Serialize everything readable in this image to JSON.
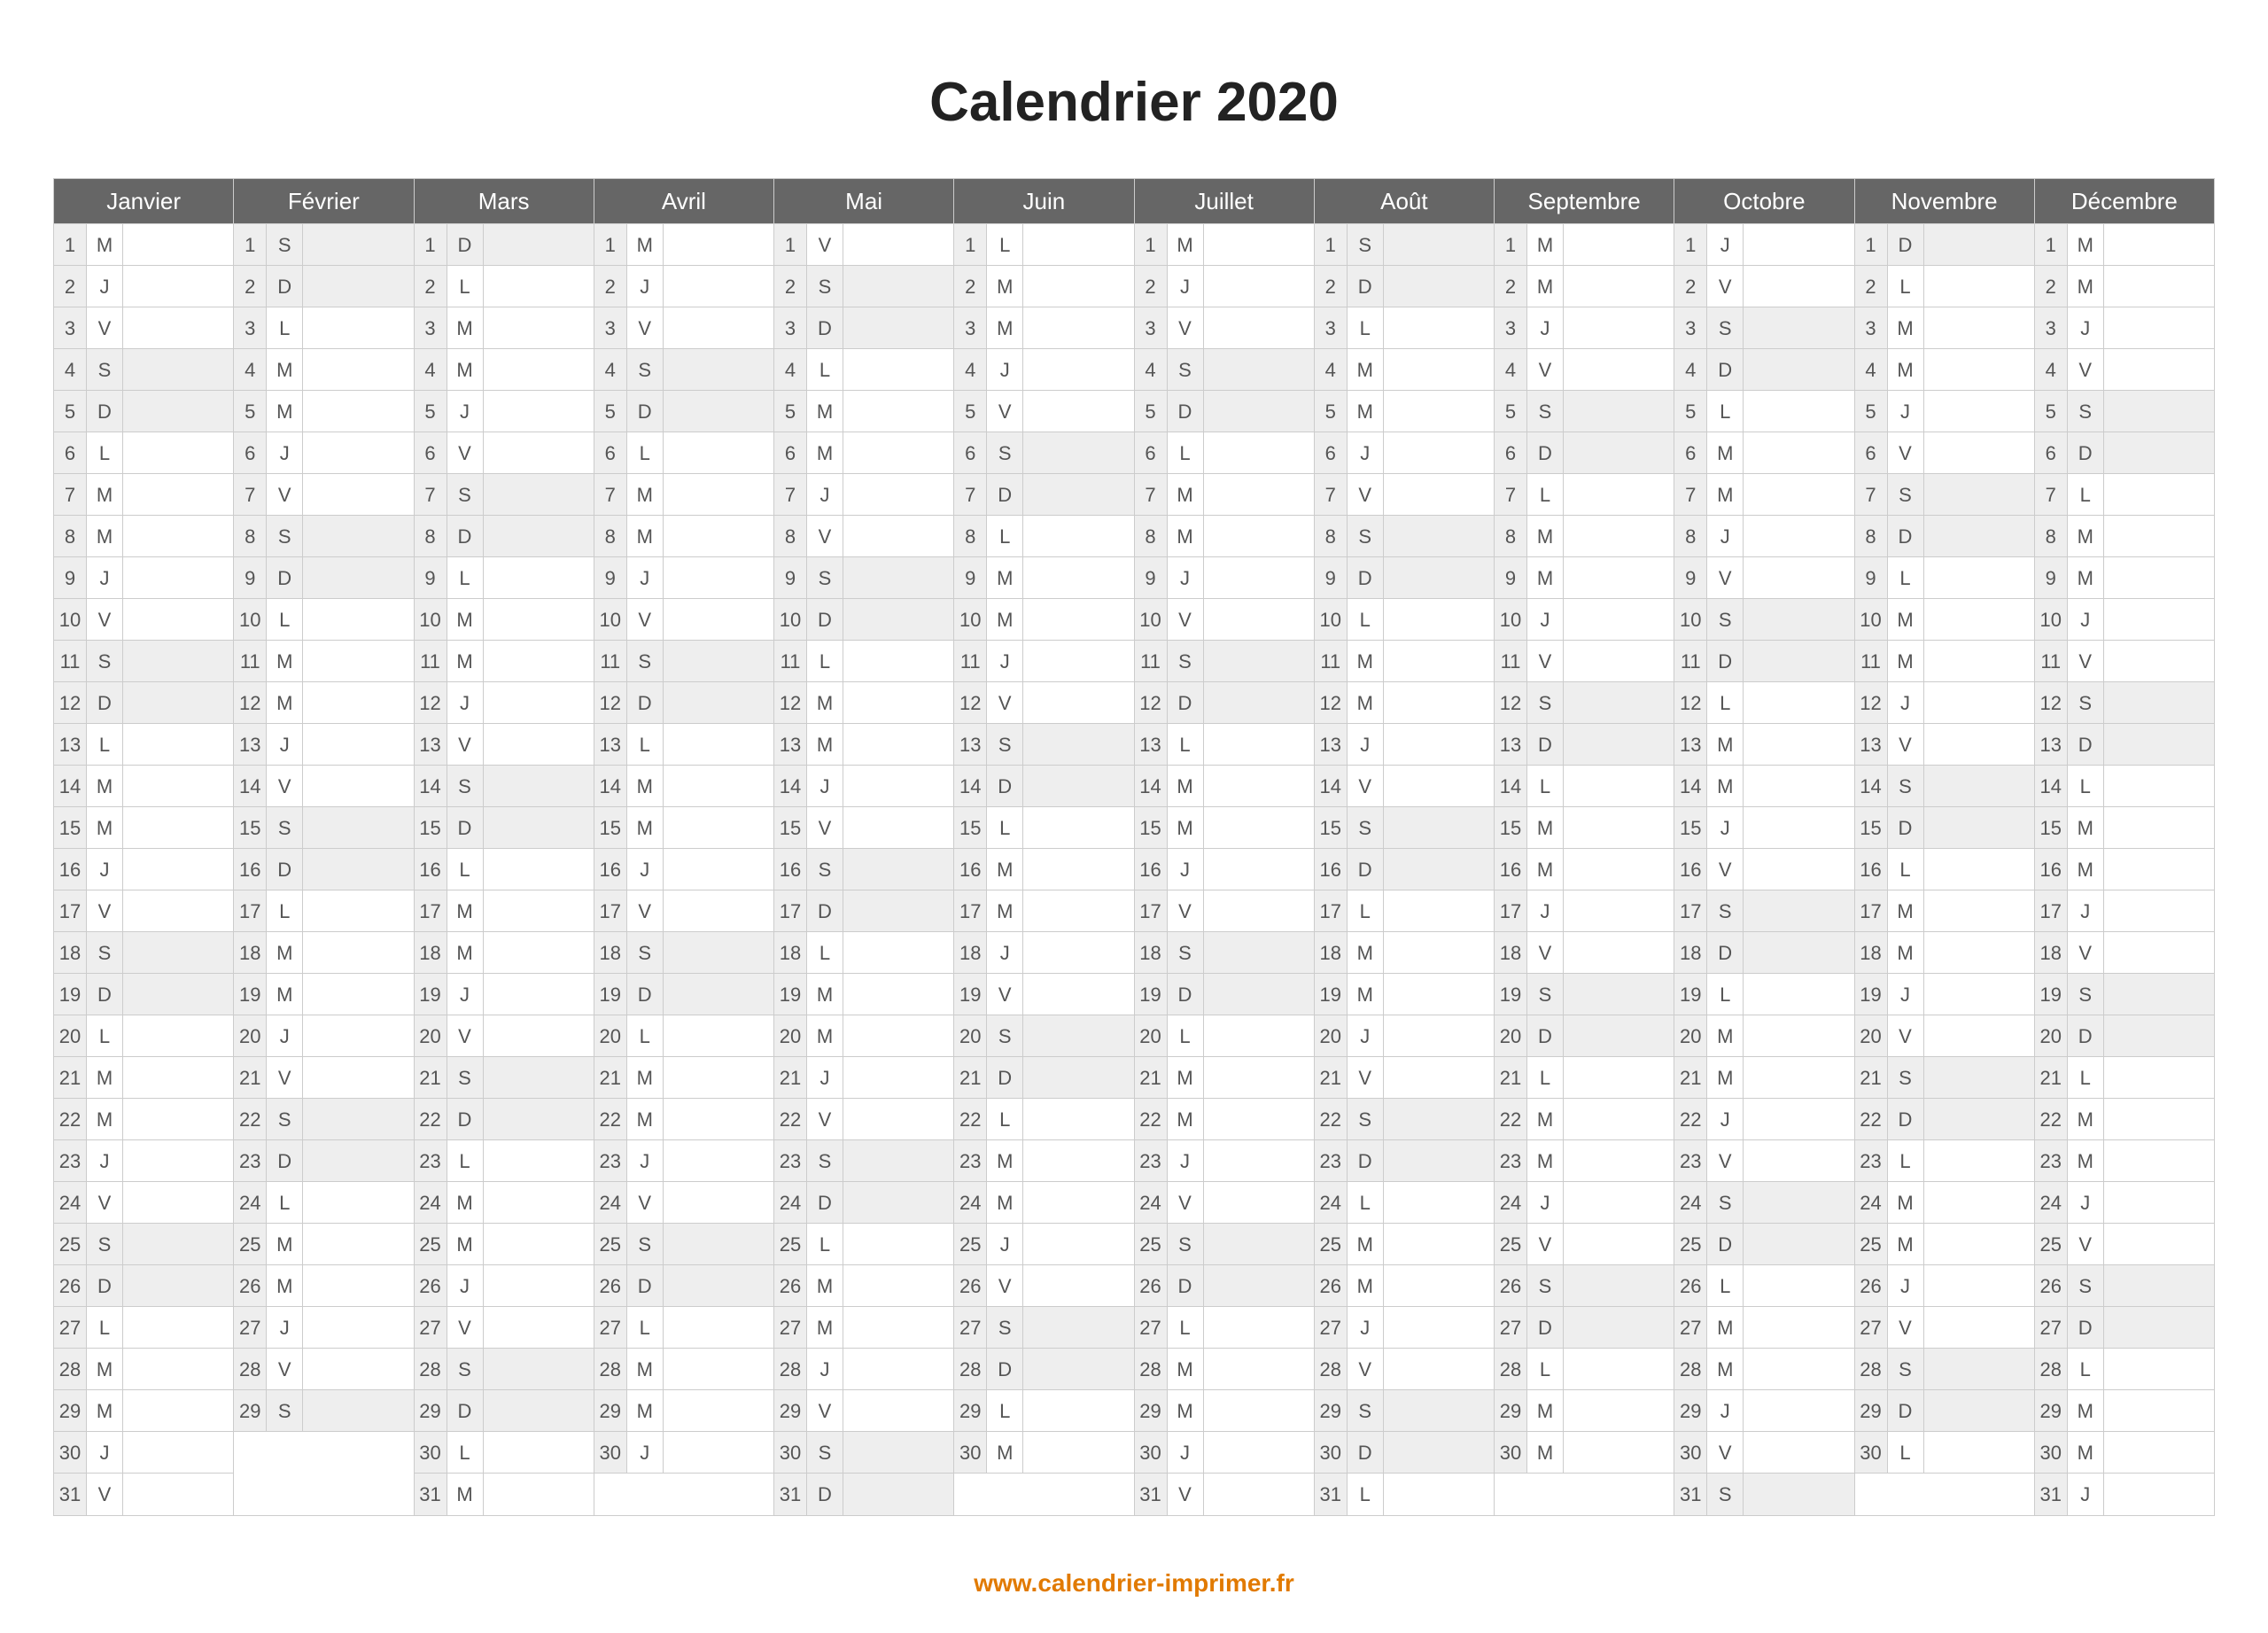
{
  "title": "Calendrier 2020",
  "footer": "www.calendrier-imprimer.fr",
  "weekend_letters": [
    "S",
    "D"
  ],
  "months": [
    {
      "name": "Janvier",
      "days": [
        "M",
        "J",
        "V",
        "S",
        "D",
        "L",
        "M",
        "M",
        "J",
        "V",
        "S",
        "D",
        "L",
        "M",
        "M",
        "J",
        "V",
        "S",
        "D",
        "L",
        "M",
        "M",
        "J",
        "V",
        "S",
        "D",
        "L",
        "M",
        "M",
        "J",
        "V"
      ]
    },
    {
      "name": "Février",
      "days": [
        "S",
        "D",
        "L",
        "M",
        "M",
        "J",
        "V",
        "S",
        "D",
        "L",
        "M",
        "M",
        "J",
        "V",
        "S",
        "D",
        "L",
        "M",
        "M",
        "J",
        "V",
        "S",
        "D",
        "L",
        "M",
        "M",
        "J",
        "V",
        "S"
      ]
    },
    {
      "name": "Mars",
      "days": [
        "D",
        "L",
        "M",
        "M",
        "J",
        "V",
        "S",
        "D",
        "L",
        "M",
        "M",
        "J",
        "V",
        "S",
        "D",
        "L",
        "M",
        "M",
        "J",
        "V",
        "S",
        "D",
        "L",
        "M",
        "M",
        "J",
        "V",
        "S",
        "D",
        "L",
        "M"
      ]
    },
    {
      "name": "Avril",
      "days": [
        "M",
        "J",
        "V",
        "S",
        "D",
        "L",
        "M",
        "M",
        "J",
        "V",
        "S",
        "D",
        "L",
        "M",
        "M",
        "J",
        "V",
        "S",
        "D",
        "L",
        "M",
        "M",
        "J",
        "V",
        "S",
        "D",
        "L",
        "M",
        "M",
        "J"
      ]
    },
    {
      "name": "Mai",
      "days": [
        "V",
        "S",
        "D",
        "L",
        "M",
        "M",
        "J",
        "V",
        "S",
        "D",
        "L",
        "M",
        "M",
        "J",
        "V",
        "S",
        "D",
        "L",
        "M",
        "M",
        "J",
        "V",
        "S",
        "D",
        "L",
        "M",
        "M",
        "J",
        "V",
        "S",
        "D"
      ]
    },
    {
      "name": "Juin",
      "days": [
        "L",
        "M",
        "M",
        "J",
        "V",
        "S",
        "D",
        "L",
        "M",
        "M",
        "J",
        "V",
        "S",
        "D",
        "L",
        "M",
        "M",
        "J",
        "V",
        "S",
        "D",
        "L",
        "M",
        "M",
        "J",
        "V",
        "S",
        "D",
        "L",
        "M"
      ]
    },
    {
      "name": "Juillet",
      "days": [
        "M",
        "J",
        "V",
        "S",
        "D",
        "L",
        "M",
        "M",
        "J",
        "V",
        "S",
        "D",
        "L",
        "M",
        "M",
        "J",
        "V",
        "S",
        "D",
        "L",
        "M",
        "M",
        "J",
        "V",
        "S",
        "D",
        "L",
        "M",
        "M",
        "J",
        "V"
      ]
    },
    {
      "name": "Août",
      "days": [
        "S",
        "D",
        "L",
        "M",
        "M",
        "J",
        "V",
        "S",
        "D",
        "L",
        "M",
        "M",
        "J",
        "V",
        "S",
        "D",
        "L",
        "M",
        "M",
        "J",
        "V",
        "S",
        "D",
        "L",
        "M",
        "M",
        "J",
        "V",
        "S",
        "D",
        "L"
      ]
    },
    {
      "name": "Septembre",
      "days": [
        "M",
        "M",
        "J",
        "V",
        "S",
        "D",
        "L",
        "M",
        "M",
        "J",
        "V",
        "S",
        "D",
        "L",
        "M",
        "M",
        "J",
        "V",
        "S",
        "D",
        "L",
        "M",
        "M",
        "J",
        "V",
        "S",
        "D",
        "L",
        "M",
        "M"
      ]
    },
    {
      "name": "Octobre",
      "days": [
        "J",
        "V",
        "S",
        "D",
        "L",
        "M",
        "M",
        "J",
        "V",
        "S",
        "D",
        "L",
        "M",
        "M",
        "J",
        "V",
        "S",
        "D",
        "L",
        "M",
        "M",
        "J",
        "V",
        "S",
        "D",
        "L",
        "M",
        "M",
        "J",
        "V",
        "S"
      ]
    },
    {
      "name": "Novembre",
      "days": [
        "D",
        "L",
        "M",
        "M",
        "J",
        "V",
        "S",
        "D",
        "L",
        "M",
        "M",
        "J",
        "V",
        "S",
        "D",
        "L",
        "M",
        "M",
        "J",
        "V",
        "S",
        "D",
        "L",
        "M",
        "M",
        "J",
        "V",
        "S",
        "D",
        "L"
      ]
    },
    {
      "name": "Décembre",
      "days": [
        "M",
        "M",
        "J",
        "V",
        "S",
        "D",
        "L",
        "M",
        "M",
        "J",
        "V",
        "S",
        "D",
        "L",
        "M",
        "M",
        "J",
        "V",
        "S",
        "D",
        "L",
        "M",
        "M",
        "J",
        "V",
        "S",
        "D",
        "L",
        "M",
        "M",
        "J"
      ]
    }
  ]
}
